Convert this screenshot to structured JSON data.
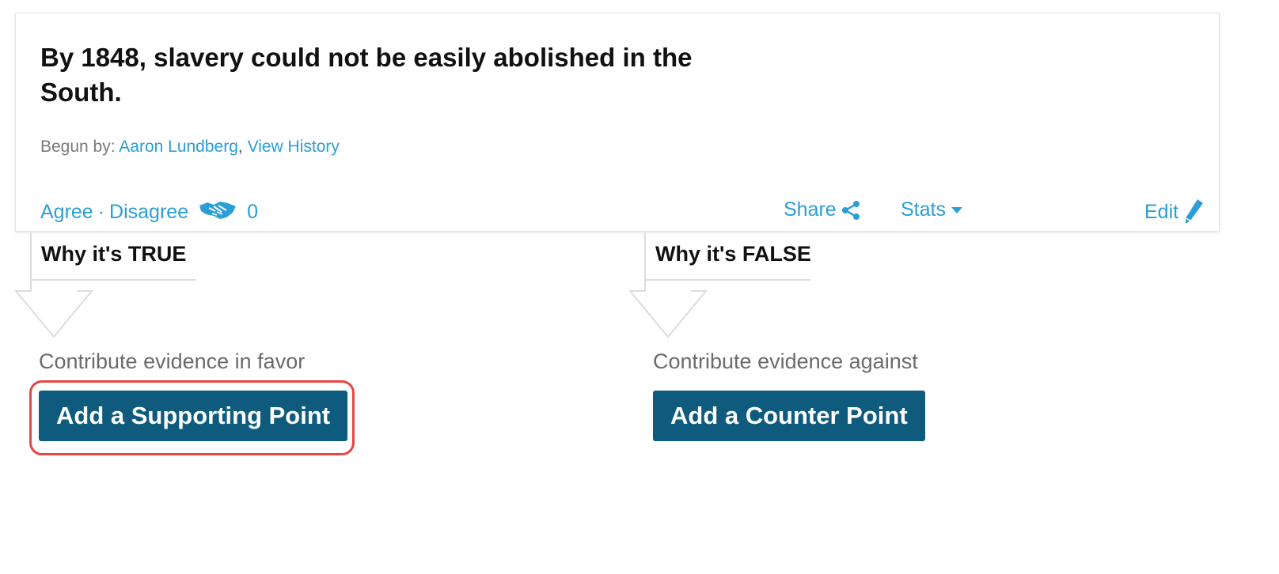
{
  "claim": {
    "title": "By 1848, slavery could not be easily abolished in the South.",
    "begun_by_label": "Begun by:",
    "author": "Aaron Lundberg",
    "separator": ",",
    "history_link": "View History"
  },
  "actions": {
    "agree": "Agree",
    "dot": "·",
    "disagree": "Disagree",
    "count": "0",
    "share": "Share",
    "stats": "Stats",
    "edit": "Edit"
  },
  "columns": {
    "true": {
      "heading": "Why it's TRUE",
      "subtitle": "Contribute evidence in favor",
      "button": "Add a Supporting Point"
    },
    "false": {
      "heading": "Why it's FALSE",
      "subtitle": "Contribute evidence against",
      "button": "Add a Counter Point"
    }
  },
  "colors": {
    "link": "#2a9ed8",
    "button": "#0e5b7e",
    "highlight": "#e84545"
  }
}
